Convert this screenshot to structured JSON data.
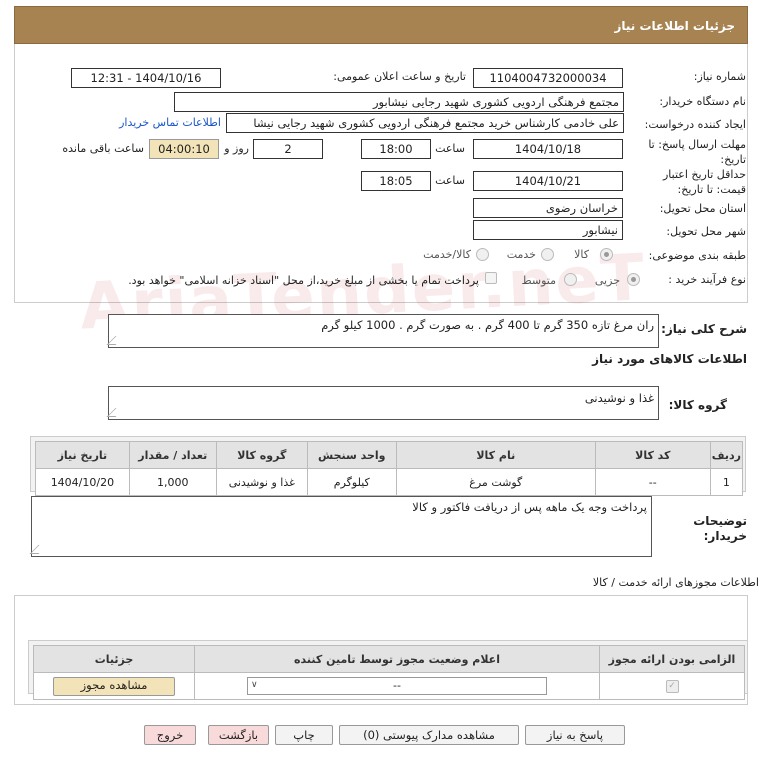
{
  "header": {
    "title": "جزئیات اطلاعات نیاز"
  },
  "form": {
    "need_number_label": "شماره نیاز:",
    "need_number": "1104004732000034",
    "announce_label": "تاریخ و ساعت اعلان عمومی:",
    "announce_value": "1404/10/16 - 12:31",
    "buyer_org_label": "نام دستگاه خریدار:",
    "buyer_org": "مجتمع فرهنگی اردویی کشوری شهید رجایی نیشابور",
    "requester_label": "ایجاد کننده درخواست:",
    "requester": "علی خادمی کارشناس خرید مجتمع فرهنگی اردویی کشوری شهید رجایی نیشا",
    "contact_link": "اطلاعات تماس خریدار",
    "deadline_label_1": "مهلت ارسال پاسخ: تا",
    "deadline_label_2": "تاریخ:",
    "deadline_date": "1404/10/18",
    "time_label": "ساعت",
    "deadline_time": "18:00",
    "days_value": "2",
    "days_label": "روز و",
    "remaining_value": "04:00:10",
    "remaining_label": "ساعت باقی مانده",
    "validity_label_1": "حداقل تاریخ اعتبار",
    "validity_label_2": "قیمت: تا تاریخ:",
    "validity_date": "1404/10/21",
    "validity_time": "18:05",
    "province_label": "استان محل تحویل:",
    "province": "خراسان رضوی",
    "city_label": "شهر محل تحویل:",
    "city": "نیشابور",
    "category_label": "طبقه بندی موضوعی:",
    "category_options": [
      "کالا",
      "خدمت",
      "کالا/خدمت"
    ],
    "process_label": "نوع فرآیند خرید :",
    "process_options": [
      "جزیی",
      "متوسط"
    ],
    "payment_note": "پرداخت تمام یا بخشی از مبلغ خرید،از محل \"اسناد خزانه اسلامی\" خواهد بود."
  },
  "description": {
    "label": "شرح کلی نیاز:",
    "text": "ران مرغ تازه 350 گرم تا 400 گرم . به صورت گرم . 1000 کیلو گرم"
  },
  "goods": {
    "section_title": "اطلاعات کالاهای مورد نیاز",
    "group_label": "گروه کالا:",
    "group_value": "غذا و نوشیدنی",
    "columns": [
      "ردیف",
      "کد کالا",
      "نام کالا",
      "واحد سنجش",
      "گروه کالا",
      "تعداد / مقدار",
      "تاریخ نیاز"
    ],
    "rows": [
      [
        "1",
        "--",
        "گوشت مرغ",
        "کیلوگرم",
        "غذا و نوشیدنی",
        "1,000",
        "1404/10/20"
      ]
    ]
  },
  "buyer_notes": {
    "label_1": "توضیحات",
    "label_2": "خریدار:",
    "text": "پرداخت وجه یک ماهه پس از دریافت فاکتور و کالا"
  },
  "permits": {
    "section_title": "اطلاعات مجوزهای ارائه خدمت / کالا",
    "columns": [
      "الزامی بودن ارائه مجوز",
      "اعلام وضعیت مجوز توسط تامین کننده",
      "جزئیات"
    ],
    "select_value": "--",
    "view_button": "مشاهده مجوز"
  },
  "actions": {
    "respond": "پاسخ به نیاز",
    "attachments": "مشاهده مدارک پیوستی (0)",
    "print": "چاپ",
    "back": "بازگشت",
    "exit": "خروج"
  },
  "colors": {
    "header_bg": "#a78352",
    "remaining_bg": "#f3e3b8",
    "link": "#1a56c8",
    "back_bg": "#f8dada",
    "exit_bg": "#f8dada"
  }
}
